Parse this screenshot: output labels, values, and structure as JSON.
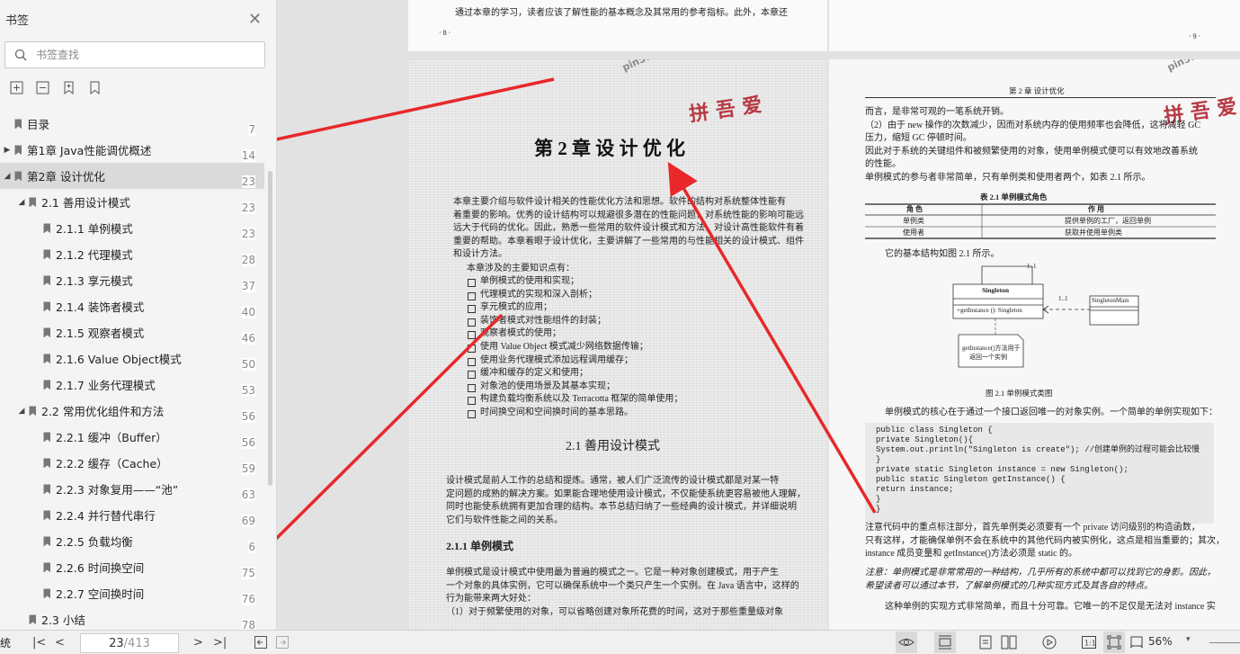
{
  "sidebar": {
    "title": "书签",
    "search_placeholder": "书签查找",
    "items": [
      {
        "label": "目录",
        "page": "7",
        "level": 0,
        "toggle": ""
      },
      {
        "label": "第1章 Java性能调优概述",
        "page": "14",
        "level": 0,
        "toggle": "▶"
      },
      {
        "label": "第2章 设计优化",
        "page": "23",
        "level": 0,
        "toggle": "◢",
        "active": true
      },
      {
        "label": "2.1 善用设计模式",
        "page": "23",
        "level": 1,
        "toggle": "◢"
      },
      {
        "label": "2.1.1 单例模式",
        "page": "23",
        "level": 2,
        "toggle": ""
      },
      {
        "label": "2.1.2 代理模式",
        "page": "28",
        "level": 2,
        "toggle": ""
      },
      {
        "label": "2.1.3 享元模式",
        "page": "37",
        "level": 2,
        "toggle": ""
      },
      {
        "label": "2.1.4 装饰者模式",
        "page": "40",
        "level": 2,
        "toggle": ""
      },
      {
        "label": "2.1.5 观察者模式",
        "page": "46",
        "level": 2,
        "toggle": ""
      },
      {
        "label": "2.1.6 Value Object模式",
        "page": "50",
        "level": 2,
        "toggle": ""
      },
      {
        "label": "2.1.7 业务代理模式",
        "page": "53",
        "level": 2,
        "toggle": ""
      },
      {
        "label": "2.2 常用优化组件和方法",
        "page": "56",
        "level": 1,
        "toggle": "◢"
      },
      {
        "label": "2.2.1 缓冲（Buffer）",
        "page": "56",
        "level": 2,
        "toggle": ""
      },
      {
        "label": "2.2.2 缓存（Cache）",
        "page": "59",
        "level": 2,
        "toggle": ""
      },
      {
        "label": "2.2.3 对象复用——“池”",
        "page": "63",
        "level": 2,
        "toggle": ""
      },
      {
        "label": "2.2.4 并行替代串行",
        "page": "69",
        "level": 2,
        "toggle": ""
      },
      {
        "label": "2.2.5 负载均衡",
        "page": "6",
        "level": 2,
        "toggle": ""
      },
      {
        "label": "2.2.6 时间换空间",
        "page": "75",
        "level": 2,
        "toggle": ""
      },
      {
        "label": "2.2.7 空间换时间",
        "page": "76",
        "level": 2,
        "toggle": ""
      },
      {
        "label": "2.3 小结",
        "page": "78",
        "level": 1,
        "toggle": ""
      }
    ]
  },
  "statusbar": {
    "left_text": "统",
    "current_page": "23",
    "total_pages": "/413",
    "zoom": "56%"
  },
  "doc": {
    "top_left_text": "通过本章的学习，读者应该了解性能的基本概念及其常用的参考指标。此外，本章还",
    "top_left_pagenum": "· 8 ·",
    "top_right_pagenum": "· 9 ·",
    "chapter_title": "第 2 章   设 计 优 化",
    "intro_lines": [
      "本章主要介绍与软件设计相关的性能优化方法和思想。软件的结构对系统整体性能有",
      "着重要的影响。优秀的设计结构可以规避很多潜在的性能问题，对系统性能的影响可能远",
      "远大于代码的优化。因此，熟悉一些常用的软件设计模式和方法，对设计高性能软件有着",
      "重要的帮助。本章着眼于设计优化，主要讲解了一些常用的与性能相关的设计模式、组件",
      "和设计方法。"
    ],
    "points_intro": "本章涉及的主要知识点有：",
    "points": [
      "单例模式的使用和实现；",
      "代理模式的实现和深入剖析；",
      "享元模式的应用；",
      "装饰者模式对性能组件的封装；",
      "观察者模式的使用；",
      "使用 Value Object 模式减少网络数据传输；",
      "使用业务代理模式添加远程调用缓存；",
      "缓冲和缓存的定义和使用；",
      "对象池的使用场景及其基本实现；",
      "构建负载均衡系统以及 Terracotta 框架的简单使用；",
      "时间换空间和空间换时间的基本思路。"
    ],
    "section_title": "2.1   善用设计模式",
    "section_lines": [
      "设计模式是前人工作的总结和提炼。通常，被人们广泛流传的设计模式都是对某一特",
      "定问题的成熟的解决方案。如果能合理地使用设计模式，不仅能使系统更容易被他人理解，",
      "同时也能使系统拥有更加合理的结构。本节总结归纳了一些经典的设计模式，并详细说明",
      "它们与软件性能之间的关系。"
    ],
    "subsection_title": "2.1.1   单例模式",
    "sub_lines": [
      "单例模式是设计模式中使用最为普遍的模式之一。它是一种对象创建模式，用于产生",
      "一个对象的具体实例，它可以确保系统中一个类只产生一个实例。在 Java 语言中，这样的",
      "行为能带来两大好处：",
      "（1）对于频繁使用的对象，可以省略创建对象所花费的时间，这对于那些重量级对象"
    ],
    "right_header": "第 2 章   设计优化",
    "right_lines_1": [
      "而言，是非常可观的一笔系统开销。",
      "（2）由于 new 操作的次数减少，因而对系统内存的使用频率也会降低，这将减轻 GC",
      "压力，缩短 GC 停顿时间。",
      "因此对于系统的关键组件和被频繁使用的对象，使用单例模式便可以有效地改善系统",
      "的性能。",
      "单例模式的参与者非常简单，只有单例类和使用者两个，如表 2.1 所示。"
    ],
    "table_caption": "表 2.1   单例模式角色",
    "table_headers": [
      "角    色",
      "作    用"
    ],
    "table_rows": [
      [
        "单例类",
        "提供单例的工厂，返回单例"
      ],
      [
        "使用者",
        "获取并使用单例类"
      ]
    ],
    "struct_line": "它的基本结构如图 2.1 所示。",
    "uml": {
      "mult1": "1..1",
      "mult2": "1..1",
      "class_name": "Singleton",
      "method": "+getInstance (): Singleton",
      "main_class": "SingletonMain",
      "note_line1": "getInstance()方法用于",
      "note_line2": "返回一个实例"
    },
    "figure_caption": "图 2.1   单例模式类图",
    "core_line": "单例模式的核心在于通过一个接口返回唯一的对象实例。一个简单的单例实现如下：",
    "code_lines": [
      "public class Singleton {",
      "    private Singleton(){",
      "        System.out.println(\"Singleton is create\"); //创建单例的过程可能会比较慢",
      "    }",
      "    private static Singleton instance = new Singleton();",
      "    public static Singleton getInstance() {",
      "        return instance;",
      "    }",
      "}"
    ],
    "right_lines_2": [
      "注意代码中的重点标注部分，首先单例类必须要有一个 private 访问级别的构造函数，",
      "只有这样，才能确保单例不会在系统中的其他代码内被实例化，这点是相当重要的；其次，",
      "instance 成员变量和 getInstance()方法必须是 static 的。"
    ],
    "note_lines": [
      "注意：单例模式是非常常用的一种结构，几乎所有的系统中都可以找到它的身影。因此，",
      "希望读者可以通过本节，了解单例模式的几种实现方式及其各自的特点。"
    ],
    "last_line": "这种单例的实现方式非常简单，而且十分可靠。它唯一的不足仅是无法对 instance 实",
    "watermark_text": "拼 吾 爱",
    "watermark_site": "pin51.com"
  },
  "colors": {
    "arrow": "#e8282b",
    "active_item": "#dadada",
    "watermark": "#b73a44"
  }
}
